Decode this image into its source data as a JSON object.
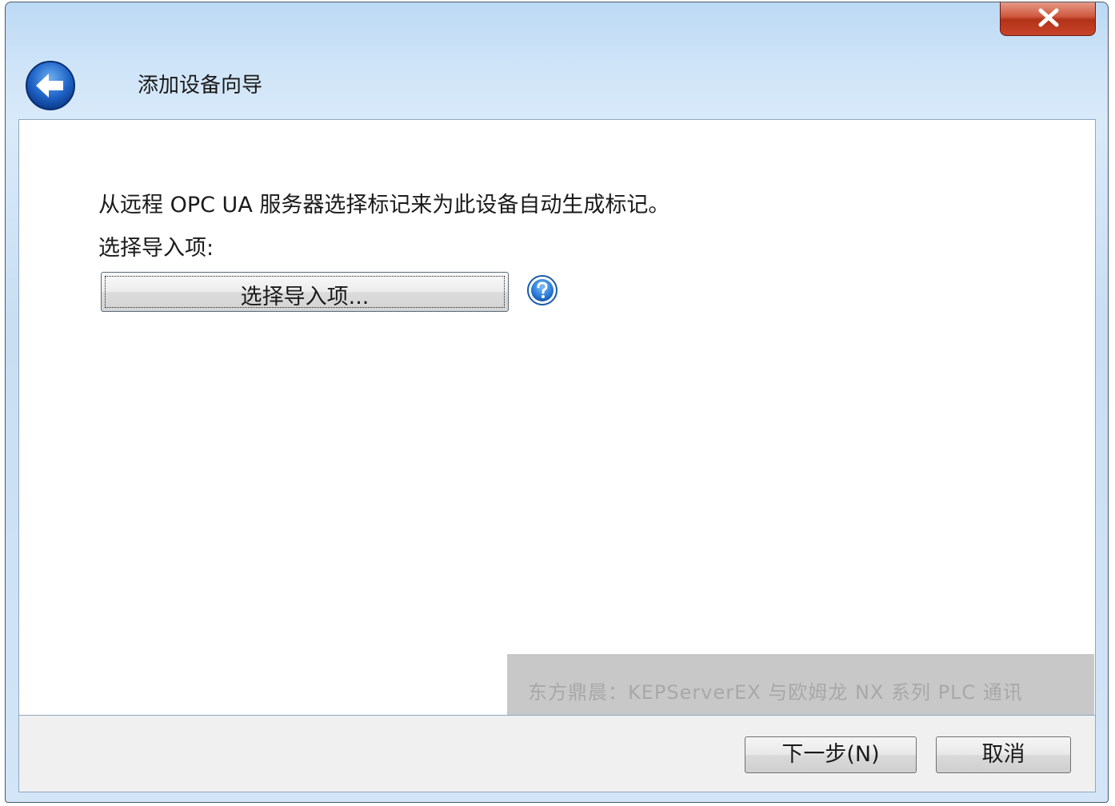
{
  "window": {
    "title": "添加设备向导"
  },
  "content": {
    "instruction": "从远程 OPC UA 服务器选择标记来为此设备自动生成标记。",
    "select_label": "选择导入项:",
    "select_button": "选择导入项..."
  },
  "watermark": {
    "text": "东方鼎晨：KEPServerEX 与欧姆龙 NX 系列 PLC 通讯"
  },
  "footer": {
    "next_label": "下一步(N)",
    "cancel_label": "取消"
  },
  "icons": {
    "back": "back-arrow-icon",
    "close": "close-icon",
    "help": "help-icon"
  },
  "colors": {
    "close_button": "#c8442a",
    "back_button": "#1f64c8",
    "help_icon": "#2a7bd8"
  }
}
